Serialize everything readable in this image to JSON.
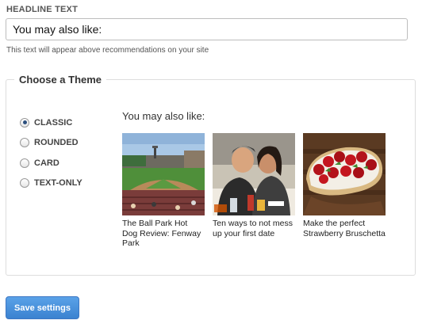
{
  "headline": {
    "label": "HEADLINE TEXT",
    "value": "You may also like:",
    "help": "This text will appear above recommendations on your site"
  },
  "theme": {
    "legend": "Choose a Theme",
    "selected": "CLASSIC",
    "options": [
      "CLASSIC",
      "ROUNDED",
      "CARD",
      "TEXT-ONLY"
    ]
  },
  "preview": {
    "title": "You may also like:",
    "cards": [
      {
        "title": "The Ball Park Hot Dog Review: Fenway Park",
        "image": "baseball-stadium-photo"
      },
      {
        "title": "Ten ways to not mess up your first date",
        "image": "couple-dinner-photo"
      },
      {
        "title": "Make the perfect Strawberry Bruschetta",
        "image": "strawberry-bruschetta-photo"
      }
    ]
  },
  "actions": {
    "save_label": "Save settings",
    "save_color": "#3b82d0"
  }
}
